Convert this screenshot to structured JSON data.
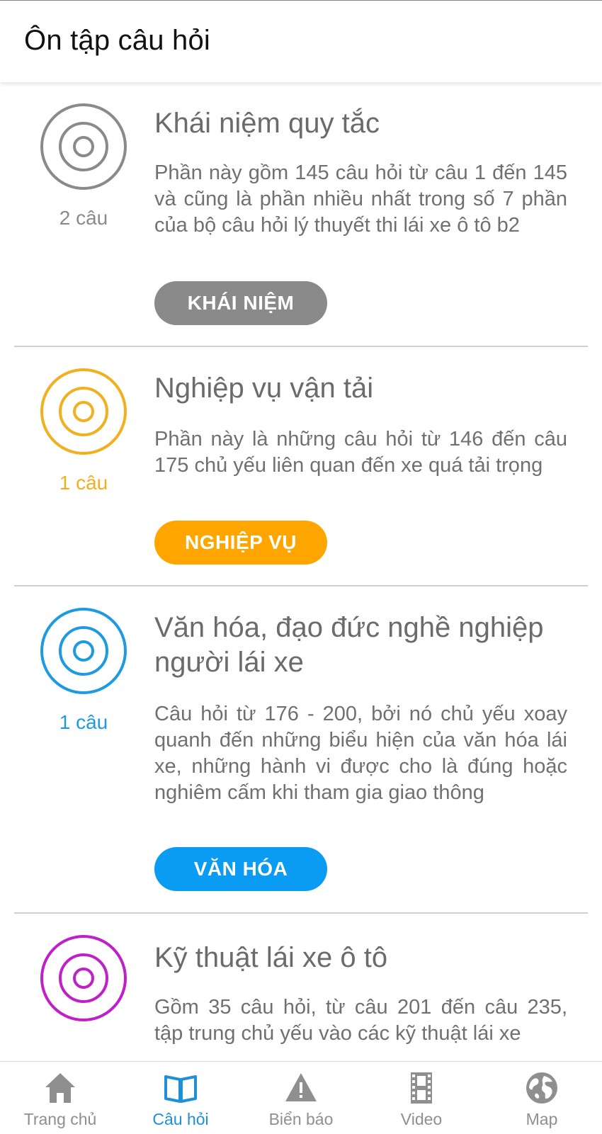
{
  "header": {
    "title": "Ôn tập câu hỏi"
  },
  "topics": [
    {
      "title": "Khái niệm quy tắc",
      "description": "Phần này gồm 145 câu hỏi từ câu 1 đến 145 và cũng là phần nhiều nhất trong số 7 phần của bộ câu hỏi lý thuyết thi lái xe ô tô b2",
      "count": "2 câu",
      "button": "KHÁI NIỆM",
      "color": "#8a8a8a",
      "button_color": "#8a8a8a",
      "icon": "target-icon"
    },
    {
      "title": "Nghiệp vụ vận tải",
      "description": "Phần này là những câu hỏi từ 146 đến câu 175 chủ yếu liên quan đến xe quá tải trọng",
      "count": "1 câu",
      "button": "NGHIỆP VỤ",
      "color": "#f0b020",
      "button_color": "#ffa500",
      "icon": "target-icon"
    },
    {
      "title": "Văn hóa, đạo đức nghề nghiệp người lái xe",
      "description": "Câu hỏi từ 176 - 200, bởi nó chủ yếu xoay quanh đến những biểu hiện của văn hóa lái xe, những hành vi được cho là đúng hoặc nghiêm cấm khi tham gia giao thông",
      "count": "1 câu",
      "button": "VĂN HÓA",
      "color": "#1e9be0",
      "button_color": "#0a9bf2",
      "icon": "target-icon"
    },
    {
      "title": "Kỹ thuật lái xe ô tô",
      "description": "Gồm 35 câu hỏi, từ câu 201 đến câu 235, tập trung chủ yếu vào các kỹ thuật lái xe",
      "color": "#c020c8",
      "icon": "target-icon"
    }
  ],
  "nav": {
    "active_color": "#1e90d8",
    "inactive_color": "#8f8f8f",
    "items": [
      {
        "label": "Trang chủ",
        "icon": "home-icon",
        "active": false
      },
      {
        "label": "Câu hỏi",
        "icon": "book-icon",
        "active": true
      },
      {
        "label": "Biển báo",
        "icon": "warning-icon",
        "active": false
      },
      {
        "label": "Video",
        "icon": "film-icon",
        "active": false
      },
      {
        "label": "Map",
        "icon": "globe-icon",
        "active": false
      }
    ]
  }
}
